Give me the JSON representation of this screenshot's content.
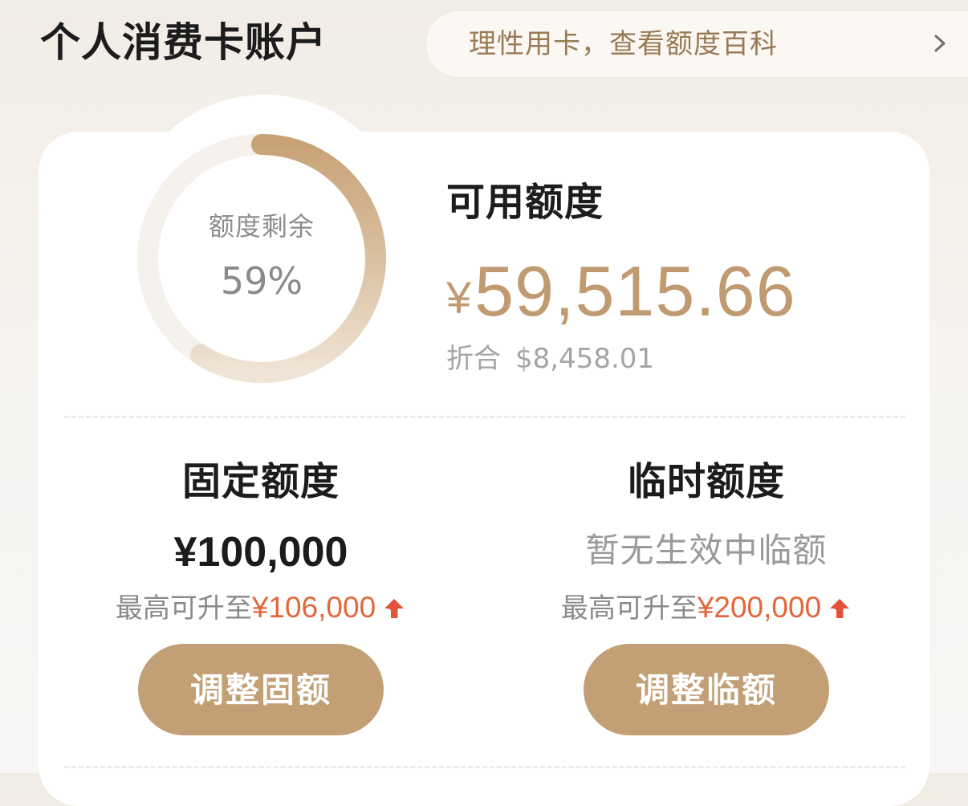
{
  "header": {
    "title": "个人消费卡账户",
    "tip": "理性用卡，查看额度百科"
  },
  "credit": {
    "remaining_label": "额度剩余",
    "remaining_percent_text": "59%",
    "remaining_percent": 59,
    "available_label": "可用额度",
    "available_currency": "¥",
    "available_amount": "59,515.66",
    "converted_label": "折合",
    "converted_amount": "$8,458.01"
  },
  "fixed": {
    "title": "固定额度",
    "amount": "¥100,000",
    "max_label": "最高可升至",
    "max_value": "¥106,000",
    "button_label": "调整固额"
  },
  "temporary": {
    "title": "临时额度",
    "status": "暂无生效中临额",
    "max_label": "最高可升至",
    "max_value": "¥200,000",
    "button_label": "调整临额"
  },
  "colors": {
    "accent": "#c29f74",
    "amount": "#c09a71",
    "highlight": "#e2673a",
    "ring_track": "#f5f1ec"
  },
  "icons": {
    "tip_arrow": "chevron-right-icon",
    "increase": "arrow-up-icon"
  }
}
